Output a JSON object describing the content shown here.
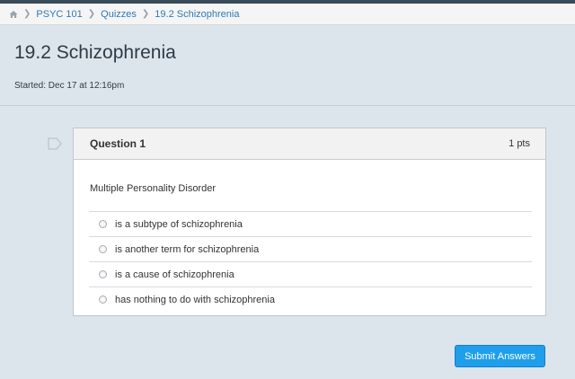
{
  "breadcrumb": {
    "home_icon": "home-icon",
    "items": [
      "PSYC 101",
      "Quizzes",
      "19.2 Schizophrenia"
    ]
  },
  "header": {
    "title": "19.2 Schizophrenia",
    "started": "Started: Dec 17 at 12:16pm"
  },
  "question": {
    "title": "Question 1",
    "points": "1 pts",
    "text": "Multiple Personality Disorder",
    "answers": [
      "is a subtype of schizophrenia",
      "is another term for schizophrenia",
      "is a cause of schizophrenia",
      "has nothing to do with schizophrenia"
    ]
  },
  "submit_label": "Submit Answers",
  "colors": {
    "link": "#2d7bb6",
    "primary_button": "#1f9eeb",
    "background": "#dde5ec"
  }
}
